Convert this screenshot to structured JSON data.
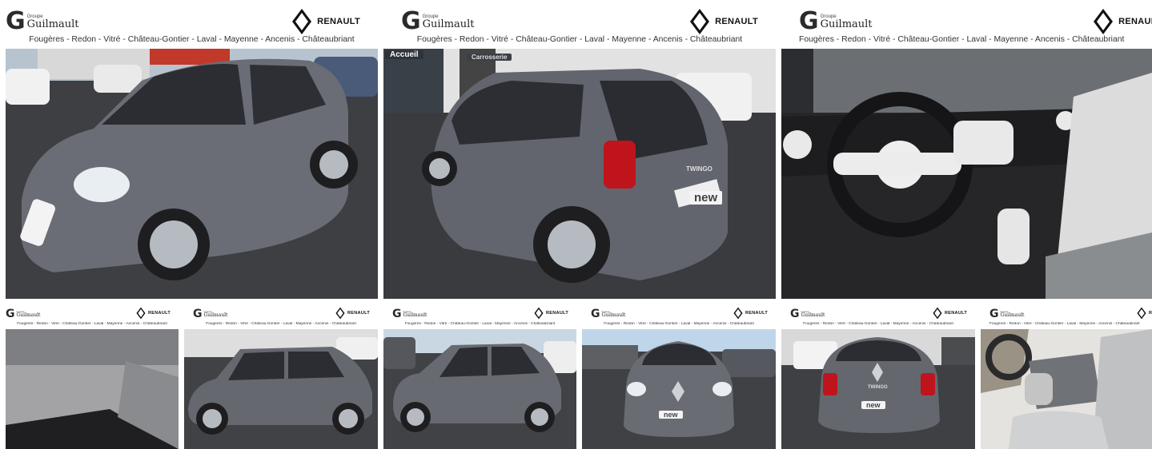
{
  "gallery": {
    "header": {
      "group_small": "Groupe",
      "group_name": "Guilmault",
      "brand_name": "RENAULT",
      "cities": "Fougères - Redon - Vitré - Château-Gontier - Laval - Mayenne - Ancenis - Châteaubriant"
    },
    "signs": {
      "accueil": "Accueil",
      "carrosserie": "Carrosserie",
      "rear_badge": "TWINGO",
      "new_badge": "new"
    },
    "colors": {
      "car_body": "#6a6d75",
      "asphalt": "#3e3f42",
      "sky": "#cfe2f3",
      "interior_light": "#e8e6e2"
    },
    "photos": [
      {
        "name": "front-three-quarter",
        "icon": "car-front-icon"
      },
      {
        "name": "rear-three-quarter",
        "icon": "car-rear-icon"
      },
      {
        "name": "dashboard",
        "icon": "steering-wheel-icon"
      },
      {
        "name": "boot",
        "icon": "boot-icon"
      },
      {
        "name": "side-left",
        "icon": "car-side-icon"
      },
      {
        "name": "side-right",
        "icon": "car-side-icon"
      },
      {
        "name": "front",
        "icon": "car-front-icon"
      },
      {
        "name": "rear",
        "icon": "car-rear-icon"
      },
      {
        "name": "seats",
        "icon": "seat-icon"
      }
    ]
  }
}
